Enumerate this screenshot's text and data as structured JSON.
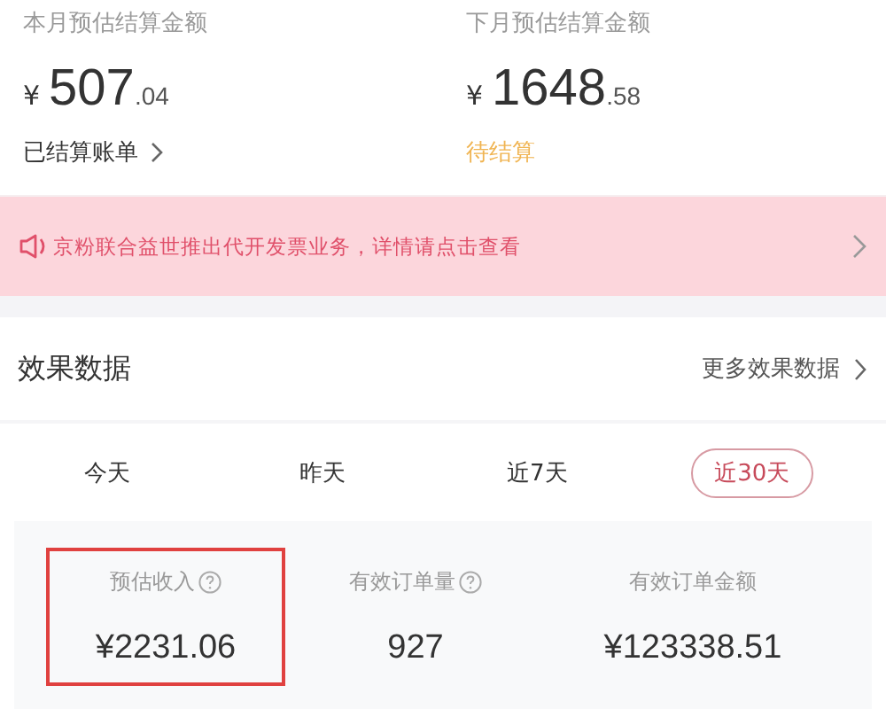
{
  "summary": [
    {
      "label": "本月预估结算金额",
      "currency": "¥",
      "integer": "507",
      "decimal": ".04",
      "link": {
        "kind": "link",
        "text": "已结算账单"
      }
    },
    {
      "label": "下月预估结算金额",
      "currency": "¥",
      "integer": "1648",
      "decimal": ".58",
      "link": {
        "kind": "status",
        "text": "待结算"
      }
    }
  ],
  "notice": {
    "text": "京粉联合益世推出代开发票业务，详情请点击查看"
  },
  "section": {
    "title": "效果数据",
    "more": "更多效果数据"
  },
  "tabs": [
    {
      "label": "今天",
      "selected": false
    },
    {
      "label": "昨天",
      "selected": false
    },
    {
      "label": "近7天",
      "selected": false
    },
    {
      "label": "近30天",
      "selected": true
    }
  ],
  "metrics": [
    {
      "label": "预估收入",
      "help": true,
      "value": "¥2231.06",
      "highlighted": true
    },
    {
      "label": "有效订单量",
      "help": true,
      "value": "927",
      "highlighted": false
    },
    {
      "label": "有效订单金额",
      "help": false,
      "value": "¥123338.51",
      "highlighted": false
    }
  ]
}
